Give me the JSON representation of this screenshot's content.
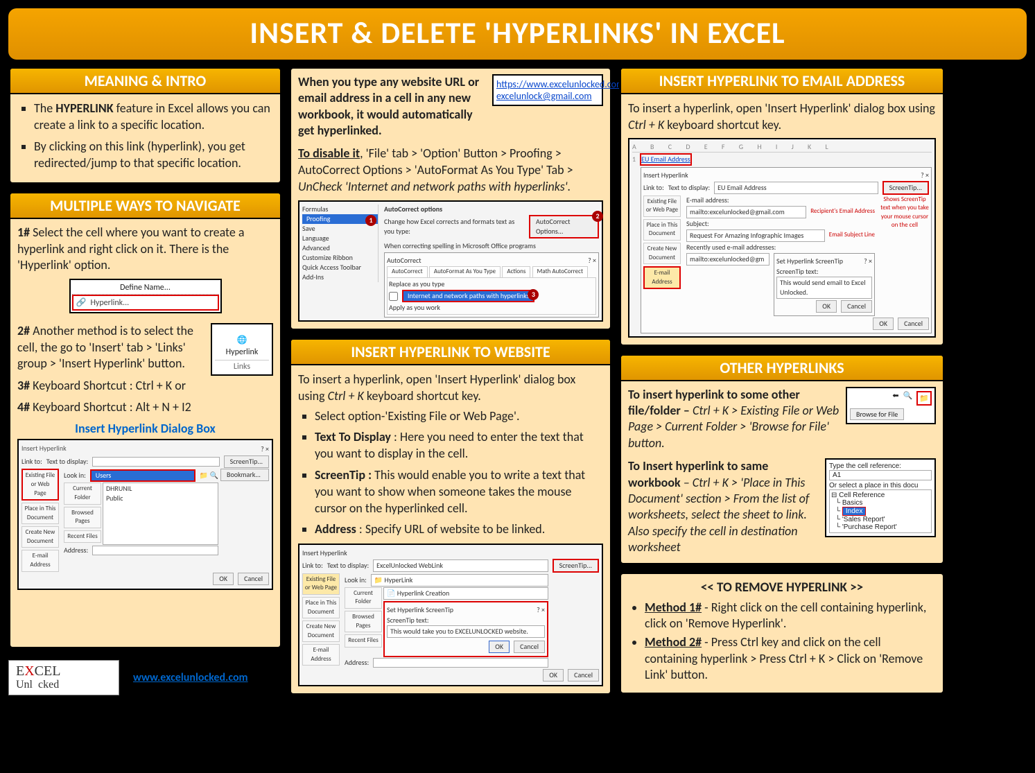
{
  "title": "INSERT & DELETE 'HYPERLINKS' IN EXCEL",
  "site_url": "www.excelunlocked.com",
  "logo": {
    "line1": "EXCEL",
    "line2": "Unl   cked"
  },
  "meaning": {
    "header": "MEANING & INTRO",
    "b1a": "The ",
    "b1b": "HYPERLINK",
    "b1c": " feature in Excel allows you can create a link to a specific location.",
    "b2": "By clicking on this link (hyperlink), you get redirected/jump to that specific location."
  },
  "navigate": {
    "header": "MULTIPLE WAYS TO NAVIGATE",
    "r1a": "1#",
    "r1b": " Select the cell where you want to create a hyperlink and right click on it. There is the 'Hyperlink' option.",
    "menu_define": "Define Name...",
    "menu_hyperlink": "Hyperlink...",
    "r2a": "2#",
    "r2b": " Another method is to select the cell, the go to 'Insert' tab > 'Links' group > 'Insert Hyperlink' button.",
    "r3a": "3#",
    "r3b": " Keyboard Shortcut : Ctrl + K or",
    "r4a": "4#",
    "r4b": " Keyboard Shortcut : Alt + N + I2",
    "dialog_caption": "Insert Hyperlink Dialog Box",
    "ribbon_hyperlink": "Hyperlink",
    "ribbon_links": "Links",
    "dlg": {
      "title": "Insert Hyperlink",
      "linkto": "Link to:",
      "texttodisplay": "Text to display:",
      "screentip": "ScreenTip...",
      "lookin": "Look in:",
      "users": "Users",
      "bookmark": "Bookmark...",
      "dhrunil": "DHRUNIL",
      "public": "Public",
      "address": "Address:",
      "ok": "OK",
      "cancel": "Cancel",
      "side1": "Existing File or Web Page",
      "side2": "Place in This Document",
      "side3": "Create New Document",
      "side4": "E-mail Address",
      "cur": "Current Folder",
      "brw": "Browsed Pages",
      "rec": "Recent Files"
    }
  },
  "auto": {
    "intro": "When you type any website URL or email address in a cell in any new workbook, it would automatically get hyperlinked.",
    "sample_url": "https://www.excelunlocked.com/",
    "sample_email": "excelunlock@gmail.com",
    "disable_a": "To disable it",
    "disable_b": ", 'File' tab > 'Option' Button > Proofing > AutoCorrect Options > 'AutoFormat As You Type' Tab > ",
    "disable_c": "UnCheck 'Internet and network paths with hyperlinks'.",
    "opts": {
      "formulas": "Formulas",
      "proofing": "Proofing",
      "save": "Save",
      "language": "Language",
      "advanced": "Advanced",
      "cust": "Customize Ribbon",
      "qat": "Quick Access Toolbar",
      "addins": "Add-Ins",
      "ac_opts_title": "AutoCorrect options",
      "ac_change": "Change how Excel corrects and formats text as you type:",
      "ac_btn": "AutoCorrect Options...",
      "spell": "When correcting spelling in Microsoft Office programs",
      "ac_dlg": "AutoCorrect",
      "tab_ac": "AutoCorrect",
      "tab_af": "AutoFormat As You Type",
      "tab_act": "Actions",
      "tab_math": "Math AutoCorrect",
      "replace": "Replace as you type",
      "internet": "Internet and network paths with hyperlinks",
      "apply": "Apply as you work"
    }
  },
  "website": {
    "header": "INSERT HYPERLINK TO WEBSITE",
    "intro_a": "To insert a hyperlink, open 'Insert Hyperlink' dialog box using ",
    "intro_b": "Ctrl + K",
    "intro_c": " keyboard shortcut key.",
    "b1": "Select option-'Existing File or Web Page'.",
    "b2a": "Text To Display",
    "b2b": " : Here you need to enter the text that you want to display in the cell.",
    "b3a": "ScreenTip :",
    "b3b": " This would enable you to write a text that you want to show when someone takes the mouse cursor on the hyperlinked cell.",
    "b4a": "Address",
    "b4b": " : Specify URL of website to be linked.",
    "dlg": {
      "title": "Insert Hyperlink",
      "linkto": "Link to:",
      "ttd": "Text to display:",
      "ttd_val": "ExcelUnlocked WebLink",
      "screentip": "ScreenTip...",
      "lookin": "Look in:",
      "folder": "HyperLink",
      "file": "Hyperlink Creation",
      "settip": "Set Hyperlink ScreenTip",
      "tiptext": "ScreenTip text:",
      "tipval": "This would take you to EXCELUNLOCKED website.",
      "ok": "OK",
      "cancel": "Cancel",
      "address": "Address:",
      "side1": "Existing File or Web Page",
      "side2": "Place in This Document",
      "side3": "Create New Document",
      "side4": "E-mail Address",
      "cur": "Current Folder",
      "brw": "Browsed Pages",
      "rec": "Recent Files"
    }
  },
  "email": {
    "header": "INSERT HYPERLINK TO EMAIL ADDRESS",
    "intro_a": "To insert a hyperlink, open 'Insert Hyperlink' dialog box using ",
    "intro_b": "Ctrl + K",
    "intro_c": " keyboard shortcut key.",
    "cell": "EU Email Address",
    "dlg": {
      "title": "Insert Hyperlink",
      "linkto": "Link to:",
      "ttd": "Text to display:",
      "ttd_val": "EU Email Address",
      "screentip": "ScreenTip...",
      "emailaddr": "E-mail address:",
      "emailval": "mailto:excelunlocked@gmail.com",
      "emailnote": "Recipient's Email Address",
      "subject": "Subject:",
      "subjectval": "Request For Amazing Infographic Images",
      "subjectnote": "Email Subject Line",
      "recent": "Recently used e-mail addresses:",
      "recentval": "mailto:excelunlocked@gm",
      "note": "Shows ScreenTip text when you take your mouse cursor on the cell",
      "settip": "Set Hyperlink ScreenTip",
      "tiptext": "ScreenTip text:",
      "tipval": "This would send email to Excel Unlocked.",
      "ok": "OK",
      "cancel": "Cancel",
      "side1": "Existing File or Web Page",
      "side2": "Place in This Document",
      "side3": "Create New Document",
      "side4": "E-mail Address"
    },
    "cols": "A  B  C  D  E  F  G  H  I  J  K  L"
  },
  "other": {
    "header": "OTHER HYPERLINKS",
    "p1a": "To insert hyperlink to some other file/folder – ",
    "p1b": "Ctrl + K > Existing File or Web Page > Current Folder > 'Browse for File' button.",
    "browse": "Browse for File",
    "p2a": "To Insert hyperlink to same workbook",
    "p2b": " – Ctrl + K > 'Place in This Document' section > From the list of worksheets, select the sheet to link. Also specify the cell in destination worksheet",
    "typecell": "Type the cell reference:",
    "a1": "A1",
    "orselect": "Or select a place in this docu",
    "tree_root": "Cell Reference",
    "tree1": "Basics",
    "tree2": "Index",
    "tree3": "'Sales Report'",
    "tree4": "'Purchase Report'"
  },
  "remove": {
    "header": "<< TO REMOVE HYPERLINK >>",
    "m1a": "Method 1#",
    "m1b": " - Right click on the cell containing hyperlink, click on 'Remove Hyperlink'.",
    "m2a": "Method 2#",
    "m2b": " - Press Ctrl key and click on the cell containing hyperlink > Press Ctrl + K > Click on 'Remove Link' button."
  }
}
